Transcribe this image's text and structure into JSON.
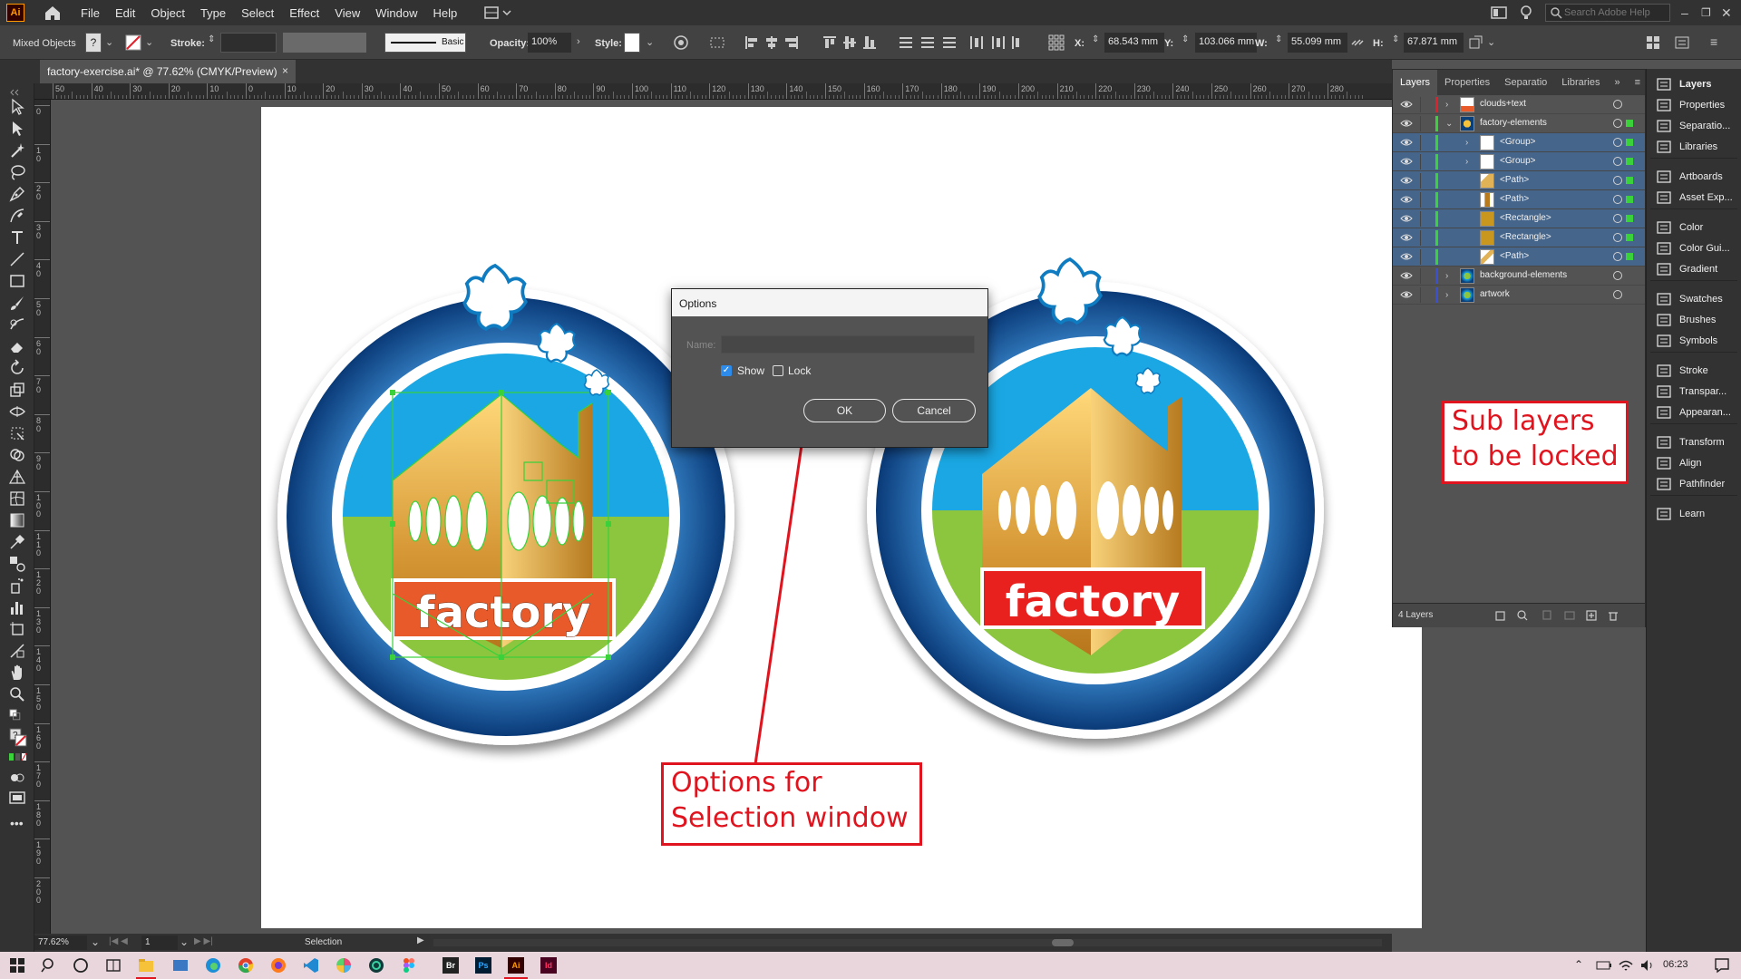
{
  "menu": {
    "logo": "Ai",
    "items": [
      "File",
      "Edit",
      "Object",
      "Type",
      "Select",
      "Effect",
      "View",
      "Window",
      "Help"
    ],
    "search_placeholder": "Search Adobe Help"
  },
  "control_bar": {
    "selection_type": "Mixed Objects",
    "fill_label": "?",
    "stroke_label": "Stroke:",
    "brush": "Basic",
    "opacity_label": "Opacity:",
    "opacity": "100%",
    "style_label": "Style:",
    "x_label": "X:",
    "x_value": "68.543 mm",
    "y_label": "Y:",
    "y_value": "103.066 mm",
    "w_label": "W:",
    "w_value": "55.099 mm",
    "h_label": "H:",
    "h_value": "67.871 mm"
  },
  "document_tab": {
    "title": "factory-exercise.ai* @ 77.62% (CMYK/Preview)",
    "close": "×"
  },
  "ruler": {
    "h_labels": [
      "50",
      "40",
      "30",
      "20",
      "10",
      "0",
      "10",
      "20",
      "30",
      "40",
      "50",
      "60",
      "70",
      "80",
      "90",
      "100",
      "110",
      "120",
      "130",
      "140",
      "150",
      "160",
      "170",
      "180",
      "190",
      "200",
      "210",
      "220",
      "230",
      "240",
      "250",
      "260",
      "270",
      "280"
    ],
    "v_labels": [
      "0",
      "1 0",
      "2 0",
      "3 0",
      "4 0",
      "5 0",
      "6 0",
      "7 0",
      "8 0",
      "9 0",
      "1 0 0",
      "1 1 0",
      "1 2 0",
      "1 3 0",
      "1 4 0",
      "1 5 0",
      "1 6 0",
      "1 7 0",
      "1 8 0",
      "1 9 0",
      "2 0 0"
    ]
  },
  "artwork": {
    "left_logo_text": "factory",
    "right_logo_text": "factory",
    "colors": {
      "ring_dark": "#0a3f7a",
      "ring_mid": "#2f7fc4",
      "sky": "#1aa7e3",
      "grass": "#8cc63f",
      "banner_left": "#e85a2a",
      "banner_right": "#e8201e",
      "building": "#e2b256",
      "selection": "#3ad13a"
    }
  },
  "dialog": {
    "title": "Options",
    "name_label": "Name:",
    "name_value": "",
    "show_label": "Show",
    "show_checked": true,
    "lock_label": "Lock",
    "lock_checked": false,
    "ok_label": "OK",
    "cancel_label": "Cancel"
  },
  "layers_panel": {
    "tabs": [
      "Layers",
      "Properties",
      "Separatio",
      "Libraries"
    ],
    "rows": [
      {
        "name": "clouds+text",
        "indent": 0,
        "expand": "›",
        "color": "#e0202a",
        "selected": false
      },
      {
        "name": "factory-elements",
        "indent": 0,
        "expand": "⌄",
        "color": "#3ad13a",
        "selected": false
      },
      {
        "name": "<Group>",
        "indent": 1,
        "expand": "›",
        "color": "#3ad13a",
        "selected": true
      },
      {
        "name": "<Group>",
        "indent": 1,
        "expand": "›",
        "color": "#3ad13a",
        "selected": true
      },
      {
        "name": "<Path>",
        "indent": 1,
        "expand": "",
        "color": "#3ad13a",
        "selected": true
      },
      {
        "name": "<Path>",
        "indent": 1,
        "expand": "",
        "color": "#3ad13a",
        "selected": true
      },
      {
        "name": "<Rectangle>",
        "indent": 1,
        "expand": "",
        "color": "#3ad13a",
        "selected": true
      },
      {
        "name": "<Rectangle>",
        "indent": 1,
        "expand": "",
        "color": "#3ad13a",
        "selected": true
      },
      {
        "name": "<Path>",
        "indent": 1,
        "expand": "",
        "color": "#3ad13a",
        "selected": true
      },
      {
        "name": "background-elements",
        "indent": 0,
        "expand": "›",
        "color": "#3a4fd1",
        "selected": false
      },
      {
        "name": "artwork",
        "indent": 0,
        "expand": "›",
        "color": "#3a4fd1",
        "selected": false
      }
    ],
    "footer_count": "4 Layers"
  },
  "dock": {
    "items": [
      "Layers",
      "Properties",
      "Separatio...",
      "Libraries",
      "Artboards",
      "Asset Exp...",
      "Color",
      "Color Gui...",
      "Gradient",
      "Swatches",
      "Brushes",
      "Symbols",
      "Stroke",
      "Transpar...",
      "Appearan...",
      "Transform",
      "Align",
      "Pathfinder",
      "Learn"
    ]
  },
  "status_bar": {
    "zoom": "77.62%",
    "artboard_num": "1",
    "tool_name": "Selection"
  },
  "annotations": {
    "sublayers": "Sub layers to be locked",
    "options": "Options for Selection window"
  },
  "taskbar": {
    "time": "06:23"
  }
}
